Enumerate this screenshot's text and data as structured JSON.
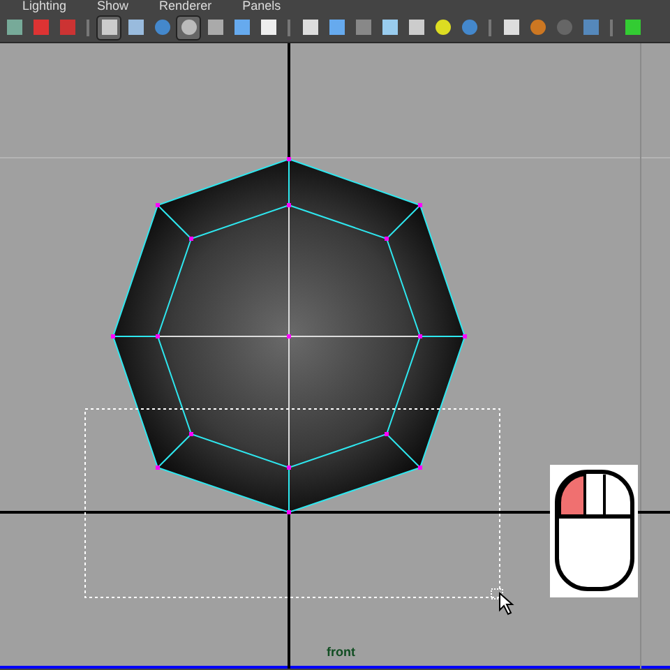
{
  "menu_bar": [
    "Lighting",
    "Show",
    "Renderer",
    "Panels"
  ],
  "viewport": {
    "camera_label": "front"
  },
  "mouse_hint": {
    "left_button_pressed": true
  }
}
